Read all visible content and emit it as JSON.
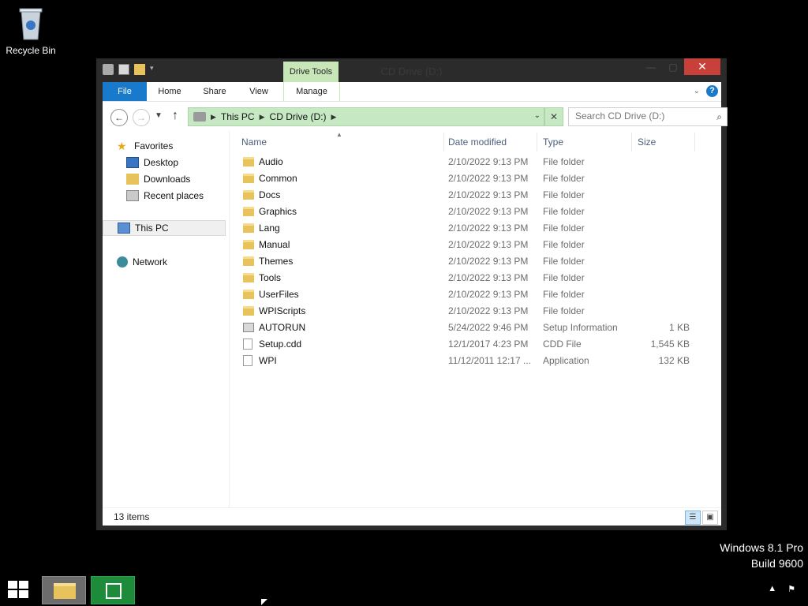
{
  "desktop": {
    "recycle_bin_label": "Recycle Bin",
    "watermark_line1": "Windows 8.1 Pro",
    "watermark_line2": "Build 9600"
  },
  "window": {
    "title": "CD Drive (D:)",
    "context_tab_group": "Drive Tools",
    "ribbon_tabs": [
      "File",
      "Home",
      "Share",
      "View",
      "Manage"
    ],
    "close_glyph": "✕"
  },
  "address": {
    "crumbs": [
      "This PC",
      "CD Drive (D:)"
    ],
    "search_placeholder": "Search CD Drive (D:)"
  },
  "navigation_pane": {
    "favorites": "Favorites",
    "desktop": "Desktop",
    "downloads": "Downloads",
    "recent_places": "Recent places",
    "this_pc": "This PC",
    "network": "Network"
  },
  "columns": {
    "name": "Name",
    "date_modified": "Date modified",
    "type": "Type",
    "size": "Size"
  },
  "files": [
    {
      "name": "Audio",
      "date": "2/10/2022 9:13 PM",
      "type": "File folder",
      "size": "",
      "icon": "folder-icon"
    },
    {
      "name": "Common",
      "date": "2/10/2022 9:13 PM",
      "type": "File folder",
      "size": "",
      "icon": "folder-icon"
    },
    {
      "name": "Docs",
      "date": "2/10/2022 9:13 PM",
      "type": "File folder",
      "size": "",
      "icon": "folder-icon"
    },
    {
      "name": "Graphics",
      "date": "2/10/2022 9:13 PM",
      "type": "File folder",
      "size": "",
      "icon": "folder-icon"
    },
    {
      "name": "Lang",
      "date": "2/10/2022 9:13 PM",
      "type": "File folder",
      "size": "",
      "icon": "folder-icon"
    },
    {
      "name": "Manual",
      "date": "2/10/2022 9:13 PM",
      "type": "File folder",
      "size": "",
      "icon": "folder-icon"
    },
    {
      "name": "Themes",
      "date": "2/10/2022 9:13 PM",
      "type": "File folder",
      "size": "",
      "icon": "folder-icon"
    },
    {
      "name": "Tools",
      "date": "2/10/2022 9:13 PM",
      "type": "File folder",
      "size": "",
      "icon": "folder-icon"
    },
    {
      "name": "UserFiles",
      "date": "2/10/2022 9:13 PM",
      "type": "File folder",
      "size": "",
      "icon": "folder-icon"
    },
    {
      "name": "WPIScripts",
      "date": "2/10/2022 9:13 PM",
      "type": "File folder",
      "size": "",
      "icon": "folder-icon"
    },
    {
      "name": "AUTORUN",
      "date": "5/24/2022 9:46 PM",
      "type": "Setup Information",
      "size": "1 KB",
      "icon": "setup-info-icon"
    },
    {
      "name": "Setup.cdd",
      "date": "12/1/2017 4:23 PM",
      "type": "CDD File",
      "size": "1,545 KB",
      "icon": "file-icon"
    },
    {
      "name": "WPI",
      "date": "11/12/2011 12:17 ...",
      "type": "Application",
      "size": "132 KB",
      "icon": "application-icon"
    }
  ],
  "status": {
    "item_count": "13 items"
  },
  "colors": {
    "ribbon_file_tab": "#1979ca",
    "drive_tools": "#c8e7b8",
    "close_button": "#c7403a"
  }
}
